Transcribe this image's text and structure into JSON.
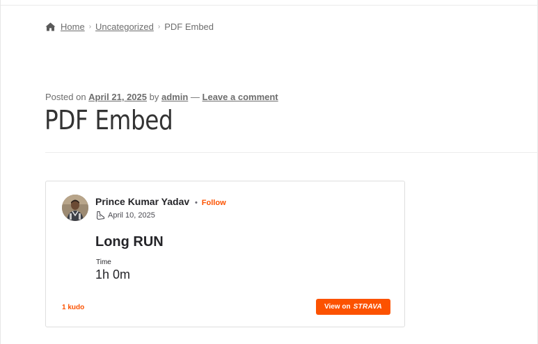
{
  "breadcrumb": {
    "home_label": "Home",
    "category_label": "Uncategorized",
    "current_label": "PDF Embed",
    "separator": "›"
  },
  "post": {
    "meta_prefix": "Posted on",
    "date": "April 21, 2025",
    "by_text": "by",
    "author": "admin",
    "dash": "—",
    "comment_link": "Leave a comment",
    "title": "PDF Embed"
  },
  "strava": {
    "athlete_name": "Prince Kumar Yadav",
    "dot": "•",
    "follow_label": "Follow",
    "activity_date": "April 10, 2025",
    "activity_icon": "shoe-icon",
    "activity_title": "Long RUN",
    "stat_label": "Time",
    "stat_value": "1h 0m",
    "kudos": "1 kudo",
    "view_on_label": "View on",
    "brand": "STRAVA",
    "accent_color": "#fc5200"
  }
}
